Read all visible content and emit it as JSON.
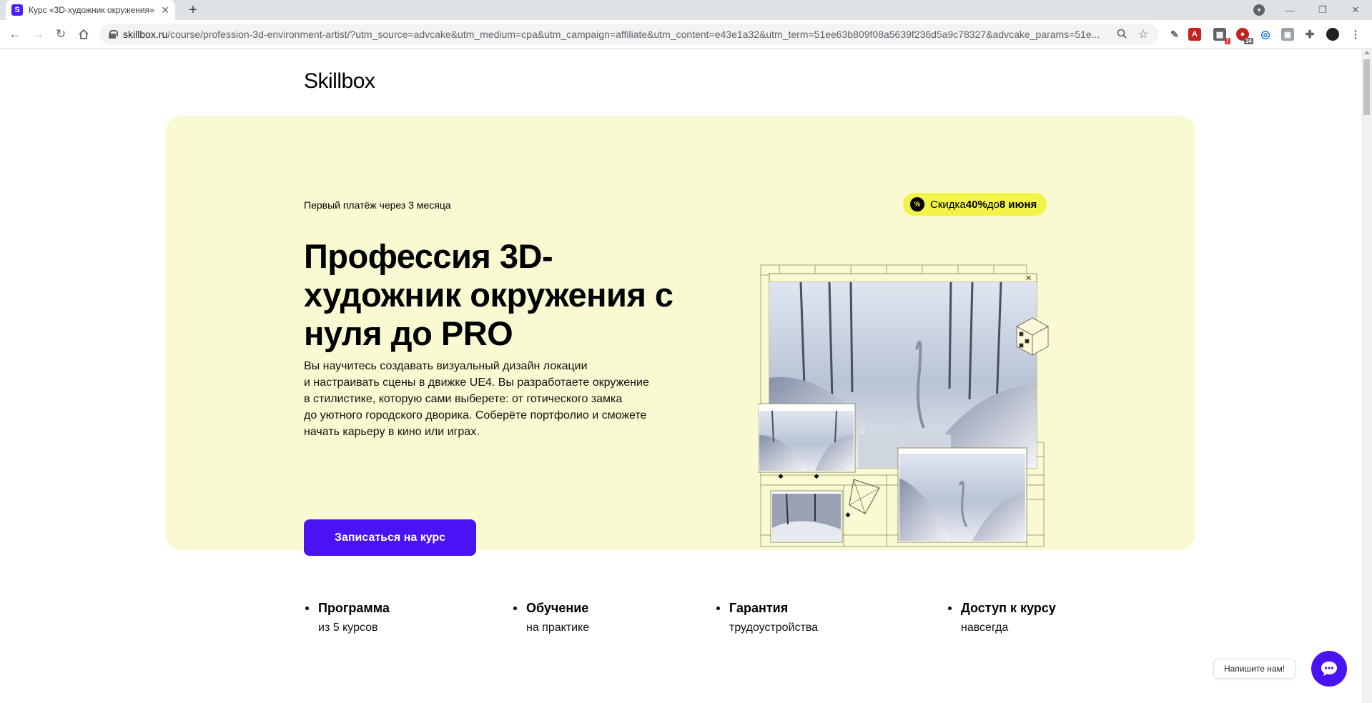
{
  "browser": {
    "tab_title": "Курс «3D-художник окружения»",
    "tab_favicon": "S",
    "url_host": "skillbox.ru",
    "url_path": "/course/profession-3d-environment-artist/?utm_source=advcake&utm_medium=cpa&utm_campaign=affiliate&utm_content=e43e1a32&utm_term=51ee63b809f08a5639f236d5a9c78327&advcake_params=51e...",
    "ext_badge_1": "7",
    "ext_badge_2": "34"
  },
  "page": {
    "logo": "Skillbox",
    "first_payment": "Первый платёж через 3 месяца",
    "discount": {
      "icon": "%",
      "prefix": "Скидка ",
      "percent": "40%",
      "mid": " до ",
      "date": "8 июня"
    },
    "title": "Профессия 3D-художник окружения с нуля до PRO",
    "description_lines": [
      "Вы научитесь создавать визуальный дизайн локации",
      "и настраивать сцены в движке UE4. Вы разработаете окружение",
      "в стилистике, которую сами выберете: от готического замка",
      "до уютного городского дворика. Соберёте портфолио и сможете",
      "начать карьеру в кино или играх."
    ],
    "cta_label": "Записаться на курс",
    "features": [
      {
        "title": "Программа",
        "subtitle": "из 5 курсов"
      },
      {
        "title": "Обучение",
        "subtitle": "на практике"
      },
      {
        "title": "Гарантия",
        "subtitle": "трудоустройства"
      },
      {
        "title": "Доступ к курсу",
        "subtitle": "навсегда"
      }
    ],
    "chat_label": "Напишите нам!"
  },
  "colors": {
    "hero_bg": "#fafad2",
    "accent": "#4a13f3",
    "discount_bg": "#f3f34a"
  }
}
